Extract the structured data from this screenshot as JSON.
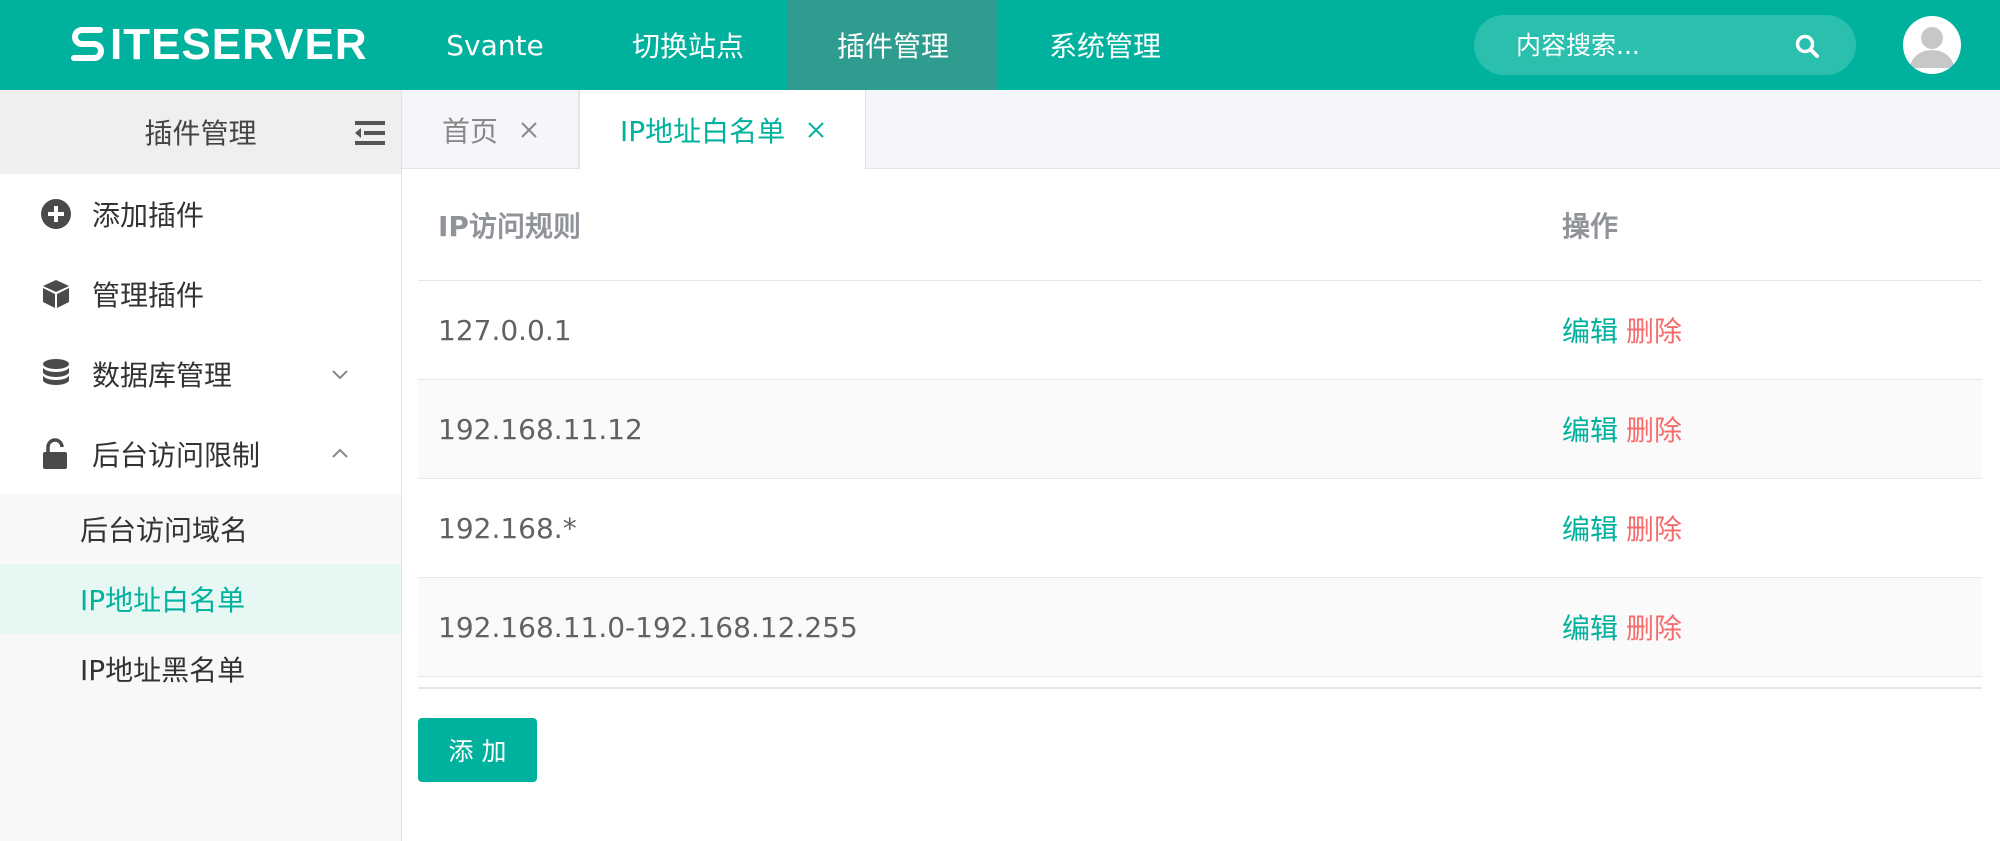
{
  "header": {
    "logo_text": "ITESERVER",
    "nav": [
      "Svante",
      "切换站点",
      "插件管理",
      "系统管理"
    ],
    "search_placeholder": "内容搜索..."
  },
  "sidebar": {
    "title": "插件管理",
    "items": [
      {
        "label": "添加插件",
        "icon": "plus-circle-icon"
      },
      {
        "label": "管理插件",
        "icon": "cube-icon"
      },
      {
        "label": "数据库管理",
        "icon": "database-icon"
      },
      {
        "label": "后台访问限制",
        "icon": "unlock-icon"
      }
    ],
    "subitems": [
      "后台访问域名",
      "IP地址白名单",
      "IP地址黑名单"
    ]
  },
  "tabs": [
    "首页",
    "IP地址白名单"
  ],
  "table": {
    "headers": [
      "IP访问规则",
      "操作"
    ],
    "rows": [
      {
        "rule": "127.0.0.1"
      },
      {
        "rule": "192.168.11.12"
      },
      {
        "rule": "192.168.*"
      },
      {
        "rule": "192.168.11.0-192.168.12.255"
      }
    ],
    "edit_label": "编辑",
    "delete_label": "删除"
  },
  "add_button": "添加",
  "colors": {
    "primary": "#00b19d",
    "danger": "#f56c6c",
    "nav_active": "#2e9d8f"
  }
}
